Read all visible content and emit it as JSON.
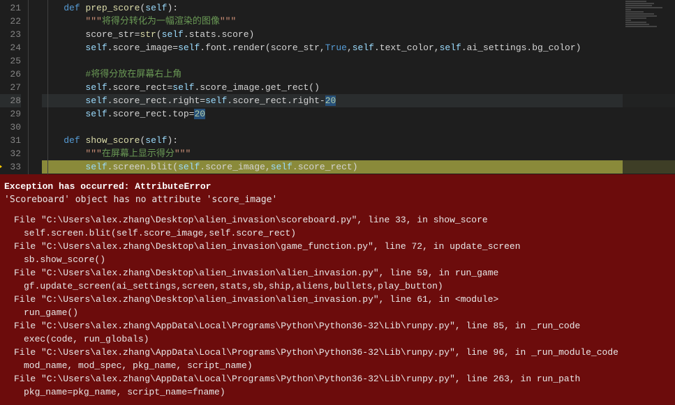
{
  "editor": {
    "lines": [
      {
        "num": "21",
        "text": "    def prep_score(self):"
      },
      {
        "num": "22",
        "text": "        \"\"\"将得分转化为一幅渲染的图像\"\"\""
      },
      {
        "num": "23",
        "text": "        score_str=str(self.stats.score)"
      },
      {
        "num": "24",
        "text": "        self.score_image=self.font.render(score_str,True,self.text_color,self.ai_settings.bg_color)"
      },
      {
        "num": "25",
        "text": ""
      },
      {
        "num": "26",
        "text": "        #将得分放在屏幕右上角"
      },
      {
        "num": "27",
        "text": "        self.score_rect=self.score_image.get_rect()"
      },
      {
        "num": "28",
        "text": "        self.score_rect.right=self.score_rect.right-20"
      },
      {
        "num": "29",
        "text": "        self.score_rect.top=20"
      },
      {
        "num": "30",
        "text": ""
      },
      {
        "num": "31",
        "text": "    def show_score(self):"
      },
      {
        "num": "32",
        "text": "        \"\"\"在屏幕上显示得分\"\"\""
      },
      {
        "num": "33",
        "text": "        self.screen.blit(self.score_image,self.score_rect)"
      }
    ],
    "current_line": "28",
    "breakpoint_line": "33"
  },
  "exception": {
    "title": "Exception has occurred: AttributeError",
    "message": "'Scoreboard' object has no attribute 'score_image'",
    "frames": [
      {
        "loc": "File \"C:\\Users\\alex.zhang\\Desktop\\alien_invasion\\scoreboard.py\", line 33, in show_score",
        "code": "self.screen.blit(self.score_image,self.score_rect)"
      },
      {
        "loc": "File \"C:\\Users\\alex.zhang\\Desktop\\alien_invasion\\game_function.py\", line 72, in update_screen",
        "code": "sb.show_score()"
      },
      {
        "loc": "File \"C:\\Users\\alex.zhang\\Desktop\\alien_invasion\\alien_invasion.py\", line 59, in run_game",
        "code": "gf.update_screen(ai_settings,screen,stats,sb,ship,aliens,bullets,play_button)"
      },
      {
        "loc": "File \"C:\\Users\\alex.zhang\\Desktop\\alien_invasion\\alien_invasion.py\", line 61, in <module>",
        "code": "run_game()"
      },
      {
        "loc": "File \"C:\\Users\\alex.zhang\\AppData\\Local\\Programs\\Python\\Python36-32\\Lib\\runpy.py\", line 85, in _run_code",
        "code": "exec(code, run_globals)"
      },
      {
        "loc": "File \"C:\\Users\\alex.zhang\\AppData\\Local\\Programs\\Python\\Python36-32\\Lib\\runpy.py\", line 96, in _run_module_code",
        "code": "mod_name, mod_spec, pkg_name, script_name)"
      },
      {
        "loc": "File \"C:\\Users\\alex.zhang\\AppData\\Local\\Programs\\Python\\Python36-32\\Lib\\runpy.py\", line 263, in run_path",
        "code": "pkg_name=pkg_name, script_name=fname)"
      }
    ]
  }
}
